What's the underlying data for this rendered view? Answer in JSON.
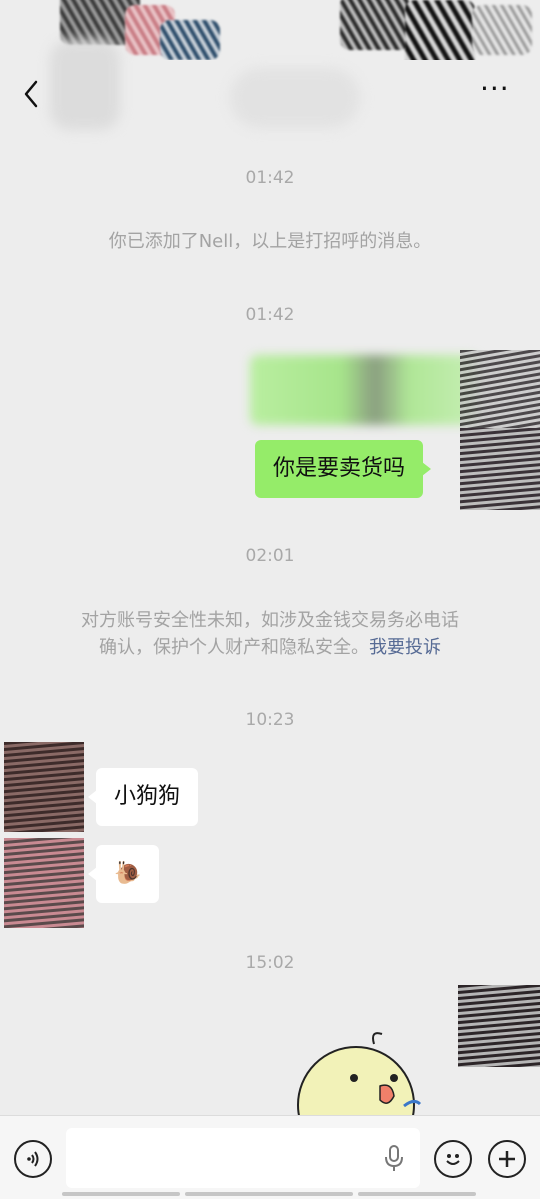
{
  "header": {
    "back_icon": "chevron-left-icon",
    "more_icon": "more-horizontal-icon",
    "more_label": "···"
  },
  "messages": {
    "time1": "01:42",
    "system_added": "你已添加了Nell，以上是打招呼的消息。",
    "time2": "01:42",
    "me_msg": "你是要卖货吗",
    "time3": "02:01",
    "warning_line1": "对方账号安全性未知，如涉及金钱交易务必电话",
    "warning_line2": "确认，保护个人财产和隐私安全。",
    "warning_link": "我要投诉",
    "time4": "10:23",
    "them_msg1": "小狗狗",
    "them_msg2": "🐌",
    "time5": "15:02"
  },
  "input_bar": {
    "voice_icon": "voice-mode-icon",
    "mic_icon": "microphone-icon",
    "emoji_icon": "emoji-face-icon",
    "plus_icon": "plus-circle-icon",
    "input_value": ""
  },
  "colors": {
    "background": "#ededed",
    "my_bubble": "#95ec69",
    "their_bubble": "#ffffff",
    "link": "#576b95",
    "meta_text": "#a9a9a9"
  }
}
